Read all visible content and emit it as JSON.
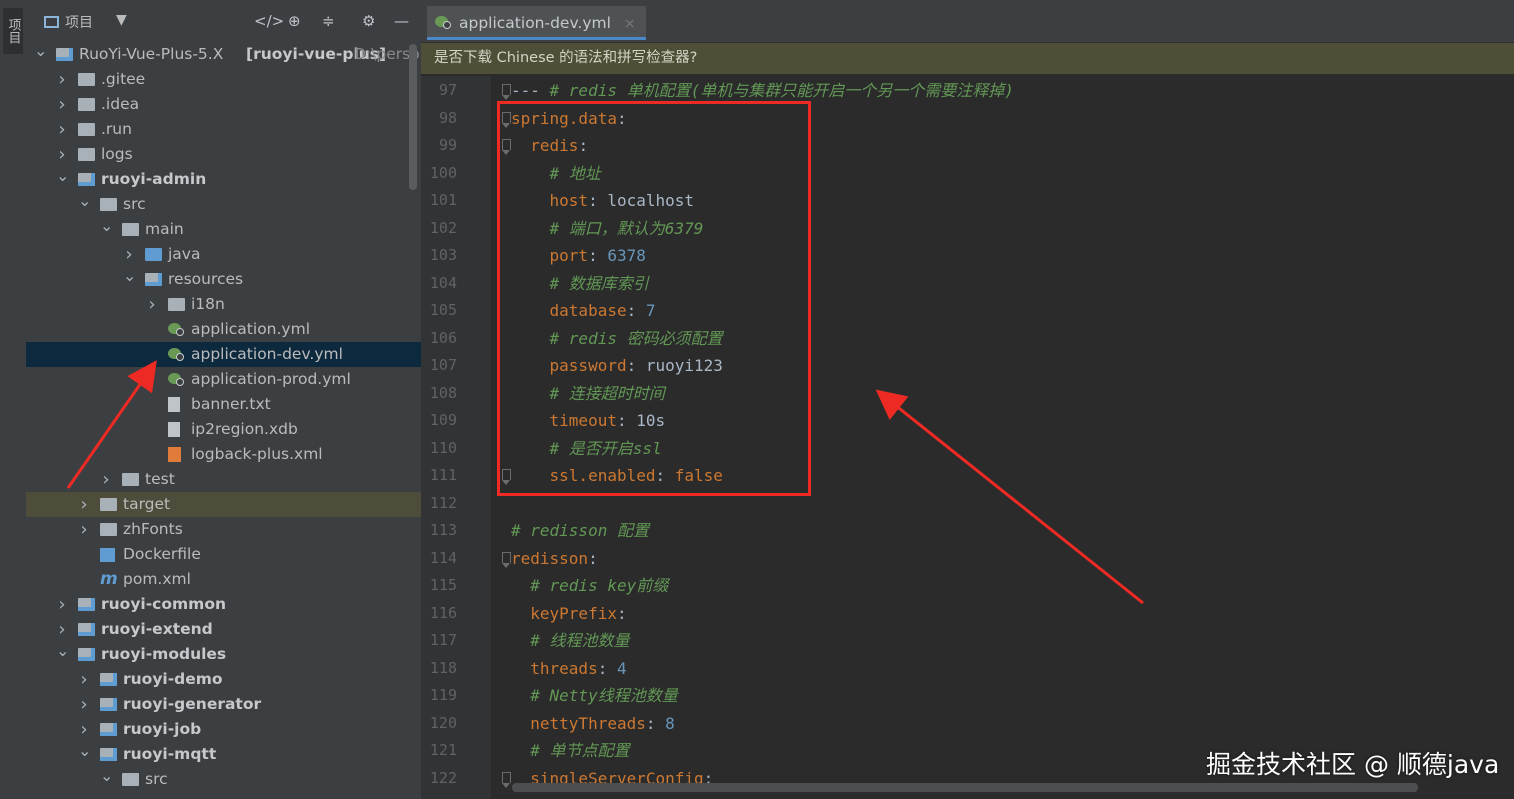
{
  "side_strip": {
    "label": "项目"
  },
  "project_panel": {
    "title": "项目",
    "tree": [
      {
        "label": "RuoYi-Vue-Plus-5.X",
        "extra": "[ruoyi-vue-plus]",
        "path": "D:\\perso"
      },
      {
        "label": ".gitee"
      },
      {
        "label": ".idea"
      },
      {
        "label": ".run"
      },
      {
        "label": "logs"
      },
      {
        "label": "ruoyi-admin"
      },
      {
        "label": "src"
      },
      {
        "label": "main"
      },
      {
        "label": "java"
      },
      {
        "label": "resources"
      },
      {
        "label": "i18n"
      },
      {
        "label": "application.yml"
      },
      {
        "label": "application-dev.yml"
      },
      {
        "label": "application-prod.yml"
      },
      {
        "label": "banner.txt"
      },
      {
        "label": "ip2region.xdb"
      },
      {
        "label": "logback-plus.xml"
      },
      {
        "label": "test"
      },
      {
        "label": "target"
      },
      {
        "label": "zhFonts"
      },
      {
        "label": "Dockerfile"
      },
      {
        "label": "pom.xml"
      },
      {
        "label": "ruoyi-common"
      },
      {
        "label": "ruoyi-extend"
      },
      {
        "label": "ruoyi-modules"
      },
      {
        "label": "ruoyi-demo"
      },
      {
        "label": "ruoyi-generator"
      },
      {
        "label": "ruoyi-job"
      },
      {
        "label": "ruoyi-mqtt"
      },
      {
        "label": "src"
      }
    ]
  },
  "editor": {
    "tab": {
      "label": "application-dev.yml",
      "close": "×"
    },
    "banner": "是否下载 Chinese 的语法和拼写检查器?",
    "lines": [
      {
        "num": "97",
        "parts": [
          [
            "v",
            "--- "
          ],
          [
            "c",
            "# redis 单机配置(单机与集群只能开启一个另一个需要注释掉)"
          ]
        ]
      },
      {
        "num": "98",
        "parts": [
          [
            "k",
            "spring.data"
          ],
          [
            "v",
            ":"
          ]
        ]
      },
      {
        "num": "99",
        "parts": [
          [
            "v",
            "  "
          ],
          [
            "k",
            "redis"
          ],
          [
            "v",
            ":"
          ]
        ]
      },
      {
        "num": "100",
        "parts": [
          [
            "v",
            "    "
          ],
          [
            "c",
            "# 地址"
          ]
        ]
      },
      {
        "num": "101",
        "parts": [
          [
            "v",
            "    "
          ],
          [
            "k",
            "host"
          ],
          [
            "v",
            ": localhost"
          ]
        ]
      },
      {
        "num": "102",
        "parts": [
          [
            "v",
            "    "
          ],
          [
            "c",
            "# 端口，默认为6379"
          ]
        ]
      },
      {
        "num": "103",
        "parts": [
          [
            "v",
            "    "
          ],
          [
            "k",
            "port"
          ],
          [
            "v",
            ": "
          ],
          [
            "n",
            "6378"
          ]
        ]
      },
      {
        "num": "104",
        "parts": [
          [
            "v",
            "    "
          ],
          [
            "c",
            "# 数据库索引"
          ]
        ]
      },
      {
        "num": "105",
        "parts": [
          [
            "v",
            "    "
          ],
          [
            "k",
            "database"
          ],
          [
            "v",
            ": "
          ],
          [
            "n",
            "7"
          ]
        ]
      },
      {
        "num": "106",
        "parts": [
          [
            "v",
            "    "
          ],
          [
            "c",
            "# redis 密码必须配置"
          ]
        ]
      },
      {
        "num": "107",
        "parts": [
          [
            "v",
            "    "
          ],
          [
            "k",
            "password"
          ],
          [
            "v",
            ": ruoyi123"
          ]
        ]
      },
      {
        "num": "108",
        "parts": [
          [
            "v",
            "    "
          ],
          [
            "c",
            "# 连接超时时间"
          ]
        ]
      },
      {
        "num": "109",
        "parts": [
          [
            "v",
            "    "
          ],
          [
            "k",
            "timeout"
          ],
          [
            "v",
            ": 10s"
          ]
        ]
      },
      {
        "num": "110",
        "parts": [
          [
            "v",
            "    "
          ],
          [
            "c",
            "# 是否开启ssl"
          ]
        ]
      },
      {
        "num": "111",
        "parts": [
          [
            "v",
            "    "
          ],
          [
            "k",
            "ssl.enabled"
          ],
          [
            "v",
            ": "
          ],
          [
            "p",
            "false"
          ]
        ]
      },
      {
        "num": "112",
        "parts": []
      },
      {
        "num": "113",
        "parts": [
          [
            "c",
            "# redisson 配置"
          ]
        ]
      },
      {
        "num": "114",
        "parts": [
          [
            "k",
            "redisson"
          ],
          [
            "v",
            ":"
          ]
        ]
      },
      {
        "num": "115",
        "parts": [
          [
            "v",
            "  "
          ],
          [
            "c",
            "# redis key前缀"
          ]
        ]
      },
      {
        "num": "116",
        "parts": [
          [
            "v",
            "  "
          ],
          [
            "k",
            "keyPrefix"
          ],
          [
            "v",
            ":"
          ]
        ]
      },
      {
        "num": "117",
        "parts": [
          [
            "v",
            "  "
          ],
          [
            "c",
            "# 线程池数量"
          ]
        ]
      },
      {
        "num": "118",
        "parts": [
          [
            "v",
            "  "
          ],
          [
            "k",
            "threads"
          ],
          [
            "v",
            ": "
          ],
          [
            "n",
            "4"
          ]
        ]
      },
      {
        "num": "119",
        "parts": [
          [
            "v",
            "  "
          ],
          [
            "c",
            "# Netty线程池数量"
          ]
        ]
      },
      {
        "num": "120",
        "parts": [
          [
            "v",
            "  "
          ],
          [
            "k",
            "nettyThreads"
          ],
          [
            "v",
            ": "
          ],
          [
            "n",
            "8"
          ]
        ]
      },
      {
        "num": "121",
        "parts": [
          [
            "v",
            "  "
          ],
          [
            "c",
            "# 单节点配置"
          ]
        ]
      },
      {
        "num": "122",
        "parts": [
          [
            "v",
            "  "
          ],
          [
            "k",
            "singleServerConfig"
          ],
          [
            "v",
            ":"
          ]
        ]
      }
    ]
  },
  "watermark": "掘金技术社区 @ 顺德java",
  "colors": {
    "annotation": "#ee2a24",
    "selection": "#0d293e",
    "banner": "#4f4f37"
  }
}
